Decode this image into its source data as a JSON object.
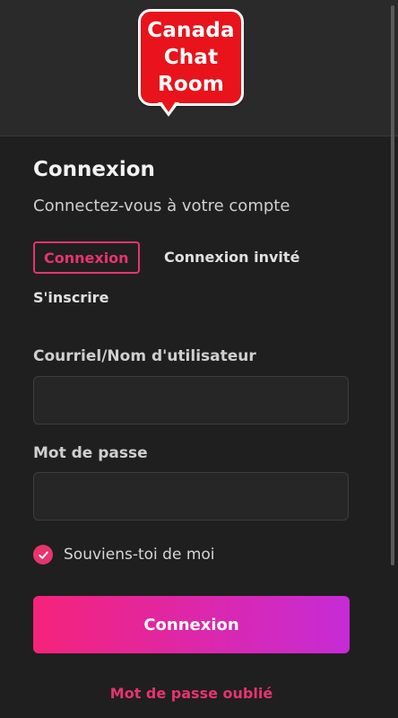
{
  "logo": {
    "lines": [
      "Canada",
      "Chat",
      "Room"
    ]
  },
  "login": {
    "title": "Connexion",
    "subtitle": "Connectez-vous à votre compte",
    "tabs": {
      "login": "Connexion",
      "guest": "Connexion invité",
      "register": "S'inscrire"
    },
    "username_label": "Courriel/Nom d'utilisateur",
    "username_value": "",
    "password_label": "Mot de passe",
    "password_value": "",
    "remember_label": "Souviens-toi de moi",
    "remember_checked": true,
    "submit_label": "Connexion",
    "forgot_label": "Mot de passe oublié"
  },
  "colors": {
    "accent": "#e8336f",
    "button_gradient_start": "#f5237a",
    "button_gradient_end": "#c62bd6",
    "logo_red": "#e8131b",
    "background": "#1f1f1f"
  }
}
